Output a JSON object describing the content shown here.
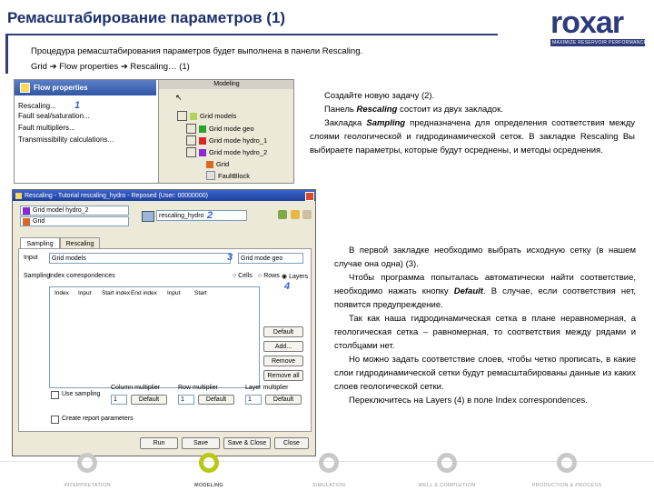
{
  "page": {
    "title": "Ремасштабирование параметров (1)",
    "intro_line1": "Процедура ремасштабирования параметров будет выполнена в панели Rescaling.",
    "intro_line2": "Grid ➔ Flow properties ➔ Rescaling… (1)"
  },
  "logo": {
    "word": "roxar",
    "tagline": "MAXIMIZE RESERVOIR PERFORMANCE"
  },
  "paragraph1": {
    "l1": "Создайте новую задачу (2).",
    "l2_pre": "Панель ",
    "l2_bold": "Rescaling",
    "l2_post": " состоит из двух закладок.",
    "l3_pre": "Закладка ",
    "l3_bold": "Sampling",
    "l3_post": " предназначена для определения соответствия между слоями геологической и гидродинамической сеток. В закладке Rescaling Вы выбираете параметры, которые будут осреднены, и методы осреднения."
  },
  "paragraph2": {
    "p1": "В первой закладке необходимо выбрать исходную сетку (в нашем случае она одна) (3).",
    "p2_pre": "Чтобы программа попыталась автоматически найти соответствие, необходимо нажать кнопку ",
    "p2_bold": "Default",
    "p2_post": ". В случае, если соответствия нет, появится предупреждение.",
    "p3": "Так как наша гидродинамическая сетка в плане неравномерная, а геологическая сетка – равномерная, то соответствия между рядами и столбцами нет.",
    "p4": "Но можно задать соответствие слоев, чтобы четко прописать, в какие слои гидродинамической сетки будут ремасштабированы данные из каких слоев геологической сетки.",
    "p5": "Переключитесь на Layers (4) в поле Index correspondences."
  },
  "shot1": {
    "menu_title": "Flow properties",
    "menu_items": [
      "Rescaling...",
      "Fault seal/saturation...",
      "Fault multipliers...",
      "Transmissibility calculations..."
    ],
    "marker": "1",
    "tree_header": "Modeling",
    "tree_items": [
      "Grid models",
      "Grid mode geo",
      "Grid mode hydro_1",
      "Grid mode hydro_2",
      "Grid",
      "FaultBlock"
    ]
  },
  "shot2": {
    "window_title": "Rescaling - Tutorial rescaling_hydro - Reposed (User: 00000000)",
    "grid_field": "Grid model hydro_2",
    "grid_field2": "Grid",
    "task_field": "rescaling_hydro",
    "marker2": "2",
    "tab_sampling": "Sampling",
    "tab_rescaling": "Rescaling",
    "input_label": "Input",
    "input_value": "Grid models",
    "source_value": "Grid mode geo",
    "marker3": "3",
    "sampling_label": "Sampling",
    "index_label": "Index correspondences",
    "radio1": "Cells",
    "radio2": "Rows",
    "radio3": "Layers",
    "marker4": "4",
    "col_headers": [
      "Index",
      "Input",
      "Start index",
      "End index",
      "Input",
      "Start"
    ],
    "btn_default": "Default",
    "btn_add": "Add...",
    "btn_remove": "Remove",
    "btn_remove_all": "Remove all",
    "use_sampling": "Use sampling",
    "col_multiplier": "Column multiplier",
    "row_multiplier": "Row multiplier",
    "layer_multiplier": "Layer multiplier",
    "mult_value": "1",
    "create_report": "Create report parameters",
    "btn_run": "Run",
    "btn_save": "Save",
    "btn_save_close": "Save & Close",
    "btn_close": "Close"
  },
  "nav": {
    "items": [
      "INTERPRETATION",
      "MODELING",
      "SIMULATION",
      "WELL & COMPLETION",
      "PRODUCTION & PROCESS"
    ],
    "active_index": 1,
    "active_color": "#b8c914",
    "inactive_color": "#c8c8c8"
  }
}
